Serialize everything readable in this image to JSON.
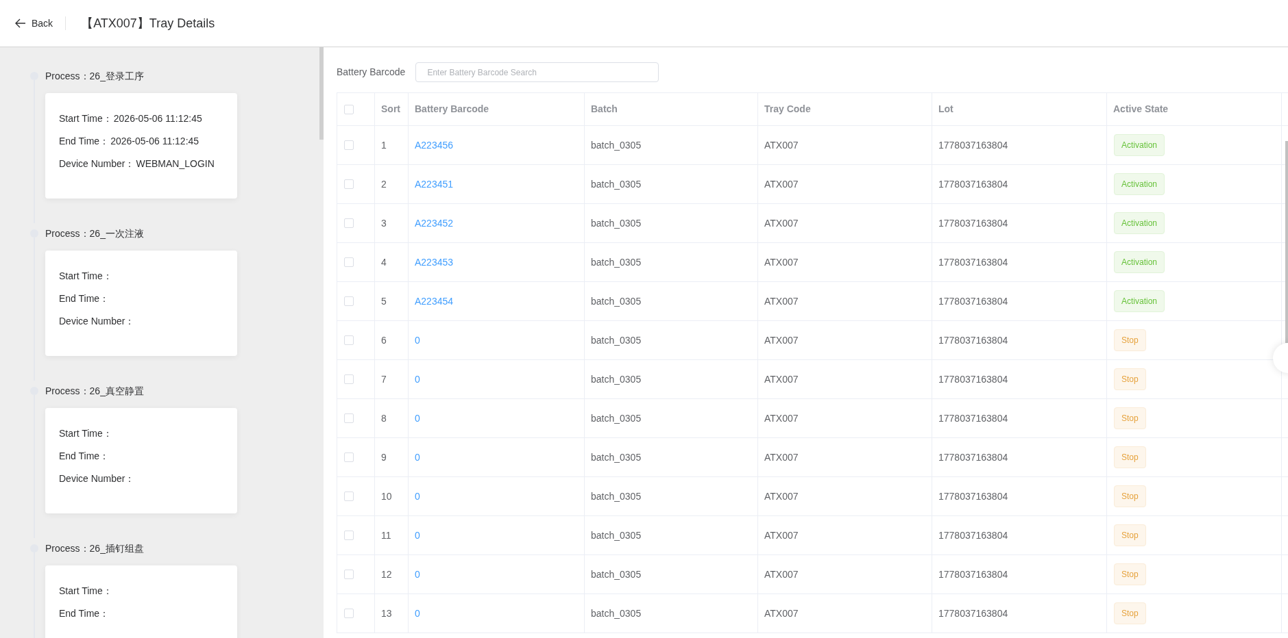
{
  "header": {
    "back": "Back",
    "title": "【ATX007】Tray Details"
  },
  "processes": [
    {
      "process": "Process：26_登录工序",
      "fields": [
        {
          "label": "Start Time：",
          "value": "2026-05-06 11:12:45"
        },
        {
          "label": "End Time：",
          "value": "2026-05-06 11:12:45"
        },
        {
          "label": "Device Number：",
          "value": "WEBMAN_LOGIN"
        }
      ]
    },
    {
      "process": "Process：26_一次注液",
      "fields": [
        {
          "label": "Start Time："
        },
        {
          "label": "End Time："
        },
        {
          "label": "Device Number："
        }
      ]
    },
    {
      "process": "Process：26_真空静置",
      "fields": [
        {
          "label": "Start Time："
        },
        {
          "label": "End Time："
        },
        {
          "label": "Device Number："
        }
      ]
    },
    {
      "process": "Process：26_插钉组盘",
      "fields": [
        {
          "label": "Start Time："
        },
        {
          "label": "End Time："
        }
      ]
    }
  ],
  "search": {
    "label": "Battery Barcode",
    "placeholder": "Enter Battery Barcode Search"
  },
  "table": {
    "select_all_checked": false,
    "columns": [
      "Sort",
      "Battery Barcode",
      "Batch",
      "Tray Code",
      "Lot",
      "Active State"
    ],
    "rows": [
      {
        "checked": false,
        "sort": "1",
        "barcode": "A223456",
        "batch": "batch_0305",
        "tray": "ATX007",
        "lot": "1778037163804",
        "state": "Activation",
        "kind": "active"
      },
      {
        "checked": false,
        "sort": "2",
        "barcode": "A223451",
        "batch": "batch_0305",
        "tray": "ATX007",
        "lot": "1778037163804",
        "state": "Activation",
        "kind": "active"
      },
      {
        "checked": false,
        "sort": "3",
        "barcode": "A223452",
        "batch": "batch_0305",
        "tray": "ATX007",
        "lot": "1778037163804",
        "state": "Activation",
        "kind": "active"
      },
      {
        "checked": false,
        "sort": "4",
        "barcode": "A223453",
        "batch": "batch_0305",
        "tray": "ATX007",
        "lot": "1778037163804",
        "state": "Activation",
        "kind": "active"
      },
      {
        "checked": false,
        "sort": "5",
        "barcode": "A223454",
        "batch": "batch_0305",
        "tray": "ATX007",
        "lot": "1778037163804",
        "state": "Activation",
        "kind": "active"
      },
      {
        "checked": false,
        "sort": "6",
        "barcode": "0",
        "batch": "batch_0305",
        "tray": "ATX007",
        "lot": "1778037163804",
        "state": "Stop",
        "kind": "stop"
      },
      {
        "checked": false,
        "sort": "7",
        "barcode": "0",
        "batch": "batch_0305",
        "tray": "ATX007",
        "lot": "1778037163804",
        "state": "Stop",
        "kind": "stop"
      },
      {
        "checked": false,
        "sort": "8",
        "barcode": "0",
        "batch": "batch_0305",
        "tray": "ATX007",
        "lot": "1778037163804",
        "state": "Stop",
        "kind": "stop"
      },
      {
        "checked": false,
        "sort": "9",
        "barcode": "0",
        "batch": "batch_0305",
        "tray": "ATX007",
        "lot": "1778037163804",
        "state": "Stop",
        "kind": "stop"
      },
      {
        "checked": false,
        "sort": "10",
        "barcode": "0",
        "batch": "batch_0305",
        "tray": "ATX007",
        "lot": "1778037163804",
        "state": "Stop",
        "kind": "stop"
      },
      {
        "checked": false,
        "sort": "11",
        "barcode": "0",
        "batch": "batch_0305",
        "tray": "ATX007",
        "lot": "1778037163804",
        "state": "Stop",
        "kind": "stop"
      },
      {
        "checked": false,
        "sort": "12",
        "barcode": "0",
        "batch": "batch_0305",
        "tray": "ATX007",
        "lot": "1778037163804",
        "state": "Stop",
        "kind": "stop"
      },
      {
        "checked": false,
        "sort": "13",
        "barcode": "0",
        "batch": "batch_0305",
        "tray": "ATX007",
        "lot": "1778037163804",
        "state": "Stop",
        "kind": "stop"
      }
    ]
  }
}
